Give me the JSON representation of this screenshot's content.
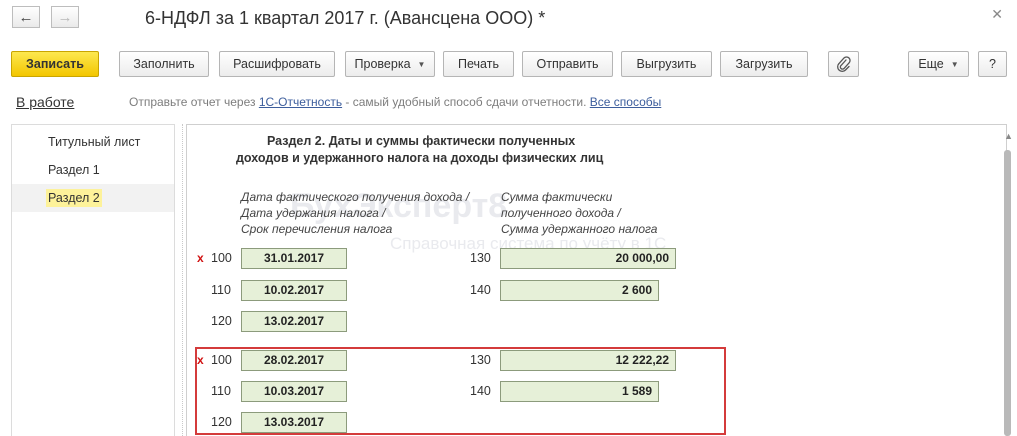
{
  "window": {
    "title": "6-НДФЛ за 1 квартал 2017 г. (Авансцена ООО) *",
    "back_icon": "arrow-left-icon",
    "forward_icon": "arrow-right-icon",
    "close_glyph": "✕"
  },
  "toolbar": {
    "save": "Записать",
    "fill": "Заполнить",
    "decode": "Расшифровать",
    "check": "Проверка",
    "print": "Печать",
    "send": "Отправить",
    "unload": "Выгрузить",
    "load": "Загрузить",
    "more": "Еще",
    "help": "?"
  },
  "status": {
    "state": "В работе",
    "info_prefix": "Отправьте отчет через ",
    "info_link": "1С-Отчетность",
    "info_middle": " - самый удобный способ сдачи отчетности. ",
    "info_link2": "Все способы"
  },
  "sidebar": {
    "items": [
      {
        "label": "Титульный лист"
      },
      {
        "label": "Раздел 1"
      },
      {
        "label": "Раздел 2"
      }
    ]
  },
  "section": {
    "title_line1": "Раздел 2.  Даты и суммы фактически полученных",
    "title_line2": "доходов и удержанного налога на доходы физических лиц",
    "col_dates": [
      "Дата фактического получения дохода /",
      "Дата удержания налога /",
      "Срок перечисления налога"
    ],
    "col_sums": [
      "Сумма фактически",
      "полученного дохода /",
      "Сумма удержанного налога"
    ]
  },
  "blocks": [
    {
      "mark": "x",
      "rows": [
        {
          "code": "100",
          "date": "31.01.2017",
          "code2": "130",
          "amount": "20 000,00"
        },
        {
          "code": "110",
          "date": "10.02.2017",
          "code2": "140",
          "amount": "2 600"
        },
        {
          "code": "120",
          "date": "13.02.2017"
        }
      ]
    },
    {
      "mark": "x",
      "rows": [
        {
          "code": "100",
          "date": "28.02.2017",
          "code2": "130",
          "amount": "12 222,22"
        },
        {
          "code": "110",
          "date": "10.03.2017",
          "code2": "140",
          "amount": "1 589"
        },
        {
          "code": "120",
          "date": "13.03.2017"
        }
      ]
    }
  ],
  "watermark": {
    "brand": "БухЭксперт8",
    "tagline": "Справочная система по учёту в 1С"
  },
  "colors": {
    "primary_button": "#f3c600",
    "field_bg": "#e6f0d8",
    "highlight_border": "#d43b3b",
    "link": "#3c5d9c",
    "active_sidebar": "#fdf29a"
  }
}
